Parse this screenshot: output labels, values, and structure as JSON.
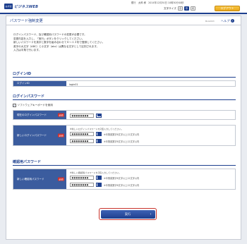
{
  "header": {
    "logo_mark": "みずほ",
    "logo_text": "ビジネスWEB",
    "user_line": "銀行　太郎 様　2014年12月30日 10時30分00秒",
    "text_size_label": "文字サイズ",
    "size_small": "小",
    "size_medium": "中",
    "size_large": "大",
    "logout_label": "ログアウト"
  },
  "page": {
    "title": "パスワード強制変更",
    "screen_id": "BLGI003",
    "help_label": "ヘルプ",
    "help_icon": "?"
  },
  "instructions": [
    "ログインパスワード、及び確認用パスワードの変更が必要です。",
    "変更内容を入力し、「実行」ボタンをクリックしてください。",
    "新しいパスワードを英字と数字を組み合わせて６～１２桁で登録してください。",
    "英字の大文字（ABC）と小文字（abc）は異なる文字として区別されます。",
    "入力は半角で行います。"
  ],
  "login_id_section": {
    "heading": "ログインID",
    "label": "ログインID",
    "value": "login01"
  },
  "login_pw_section": {
    "heading": "ログインパスワード",
    "software_kbd_label": "ソフトウェアキーボードを使用",
    "software_kbd_checked": true,
    "current_label": "現在のログインパスワード",
    "new_label": "新しいログインパスワード",
    "required_badge": "必須",
    "masked": "●●●●●●●●",
    "new_hint": "※新しいログインパスワードを2回入力してください。",
    "note": "※半角英数字6文字以上12文字以内"
  },
  "confirm_pw_section": {
    "heading": "確認用パスワード",
    "new_label": "新しい確認用パスワード",
    "required_badge": "必須",
    "masked": "●●●●●●●●",
    "new_hint": "※新しい確認用パスワードを2回入力してください。",
    "note": "※半角英数字6文字以上12文字以内"
  },
  "actions": {
    "execute_label": "実行",
    "execute_arrow": "›"
  },
  "colors": {
    "brand": "#1d3f8e",
    "label_bg": "#3b5c9e",
    "required": "#d2312d",
    "logout": "#e9a81a"
  }
}
